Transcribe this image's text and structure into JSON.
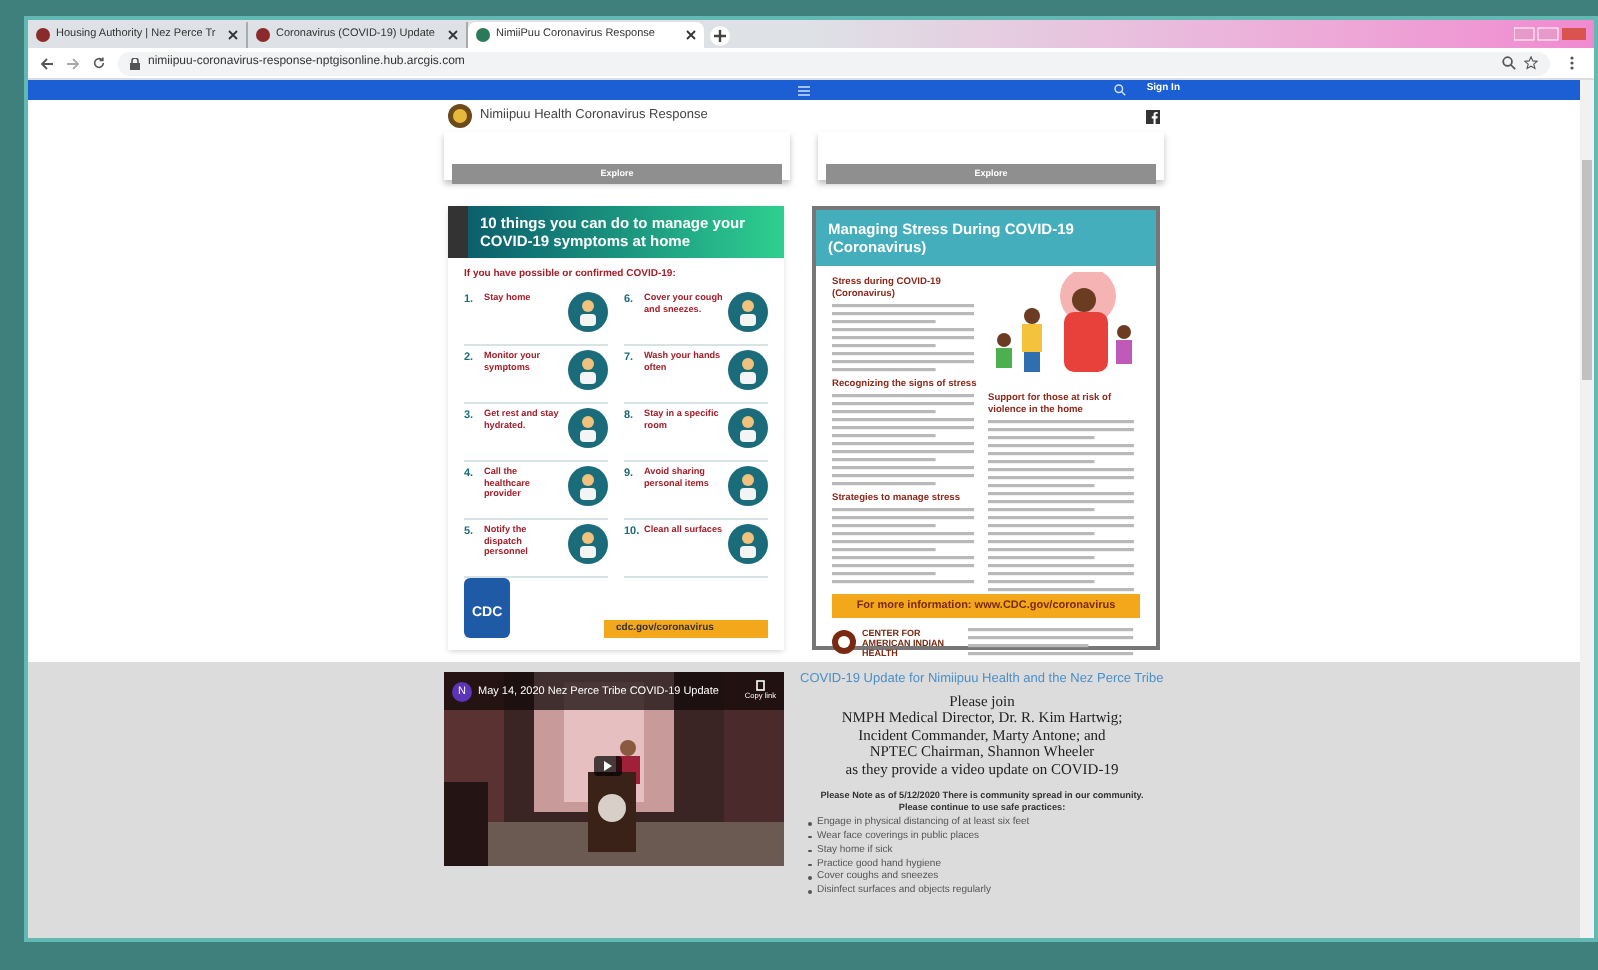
{
  "tabs": [
    {
      "title": "Housing Authority | Nez Perce Tr",
      "selected": false
    },
    {
      "title": "Coronavirus (COVID-19) Update",
      "selected": false
    },
    {
      "title": "NimiiPuu Coronavirus Response",
      "selected": true
    }
  ],
  "address": "nimiipuu-coronavirus-response-nptgisonline.hub.arcgis.com",
  "nav": {
    "sign_in": "Sign In"
  },
  "site_title": "Nimiipuu Health Coronavirus Response",
  "explore_buttons": [
    "Explore",
    "Explore"
  ],
  "poster_symptoms": {
    "title": "10 things you can do to manage your COVID-19 symptoms at home",
    "subtitle": "If you have possible or confirmed COVID-19:",
    "items": [
      {
        "number": "1.",
        "title": "Stay home"
      },
      {
        "number": "6.",
        "title": "Cover your cough and sneezes."
      },
      {
        "number": "2.",
        "title": "Monitor your symptoms"
      },
      {
        "number": "7.",
        "title": "Wash your hands often"
      },
      {
        "number": "3.",
        "title": "Get rest and stay hydrated."
      },
      {
        "number": "8.",
        "title": "Stay in a specific room"
      },
      {
        "number": "4.",
        "title": "Call the healthcare provider"
      },
      {
        "number": "9.",
        "title": "Avoid sharing personal items"
      },
      {
        "number": "5.",
        "title": "Notify the dispatch personnel"
      },
      {
        "number": "10.",
        "title": "Clean all surfaces"
      }
    ],
    "logo": "CDC",
    "footer": "cdc.gov/coronavirus"
  },
  "poster_stress": {
    "title": "Managing Stress During COVID-19 (Coronavirus)",
    "left_headings": [
      "Stress during COVID-19 (Coronavirus)",
      "Recognizing the signs of stress",
      "Strategies to manage stress"
    ],
    "right_heading": "Support for those at risk of violence in the home",
    "info_bar": "For more information:  www.CDC.gov/coronavirus",
    "footer_logo": "CENTER FOR AMERICAN INDIAN HEALTH"
  },
  "video": {
    "channel_initial": "N",
    "title": "May 14, 2020 Nez Perce Tribe COVID-19 Update",
    "copy_link": "Copy link"
  },
  "update": {
    "heading": "COVID-19 Update for Nimiipuu Health and the Nez Perce Tribe",
    "announcement_lines": [
      "Please join",
      "NMPH Medical Director, Dr. R. Kim Hartwig;",
      "Incident Commander, Marty Antone; and",
      "NPTEC Chairman, Shannon Wheeler",
      "as they provide a video update on COVID-19"
    ],
    "note": "Please Note as of 5/12/2020 There is community spread in our community.  Please continue to use safe practices:",
    "practices": [
      "Engage in physical distancing of at least six feet",
      "Wear face coverings in public places",
      "Stay home if sick",
      "Practice good hand hygiene",
      "Cover coughs and sneezes",
      "Disinfect surfaces and objects regularly"
    ]
  }
}
